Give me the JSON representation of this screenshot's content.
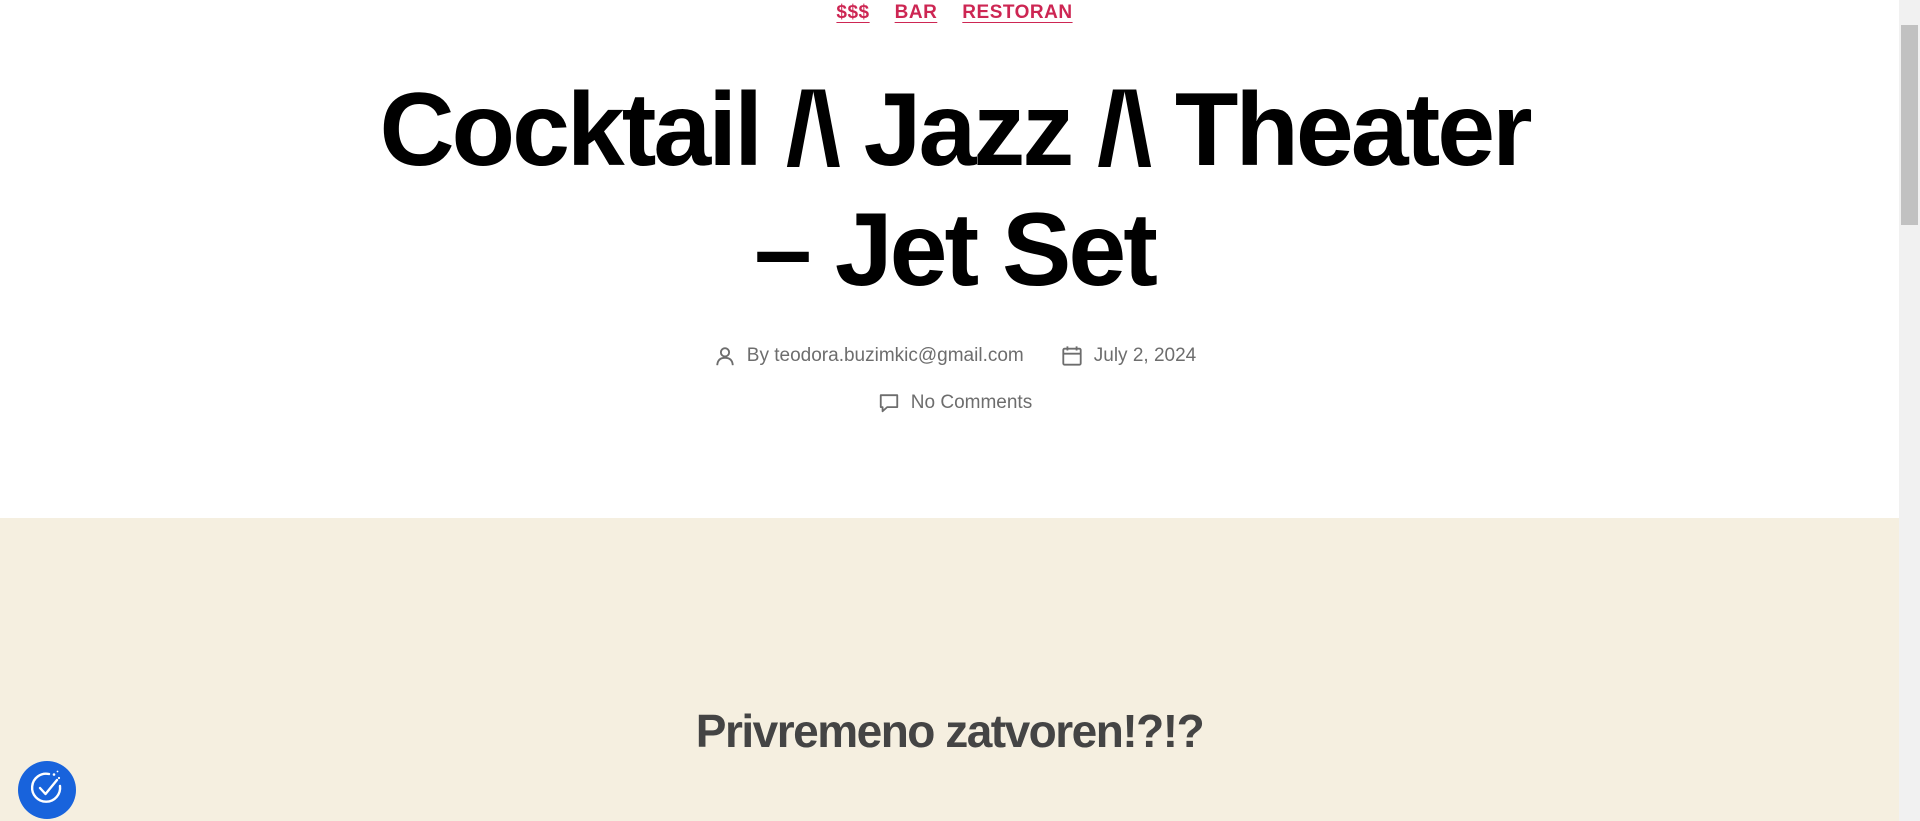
{
  "categories": [
    "$$$",
    "BAR",
    "RESTORAN"
  ],
  "post": {
    "title_line1": "Cocktail /\\ Jazz /\\ Theater",
    "title_line2": "– Jet Set",
    "author_prefix": "By",
    "author": "teodora.buzimkic@gmail.com",
    "date": "July 2, 2024",
    "comments": "No Comments"
  },
  "cover": {
    "heading": "Privremeno zatvoren!?!?"
  },
  "icons": {
    "author": "person-icon",
    "date": "calendar-icon",
    "comments": "comment-icon",
    "consent": "cookie-consent-icon"
  },
  "colors": {
    "accent": "#cd2653",
    "cover_bg": "#f5efe0",
    "consent_bg": "#1863dc"
  }
}
